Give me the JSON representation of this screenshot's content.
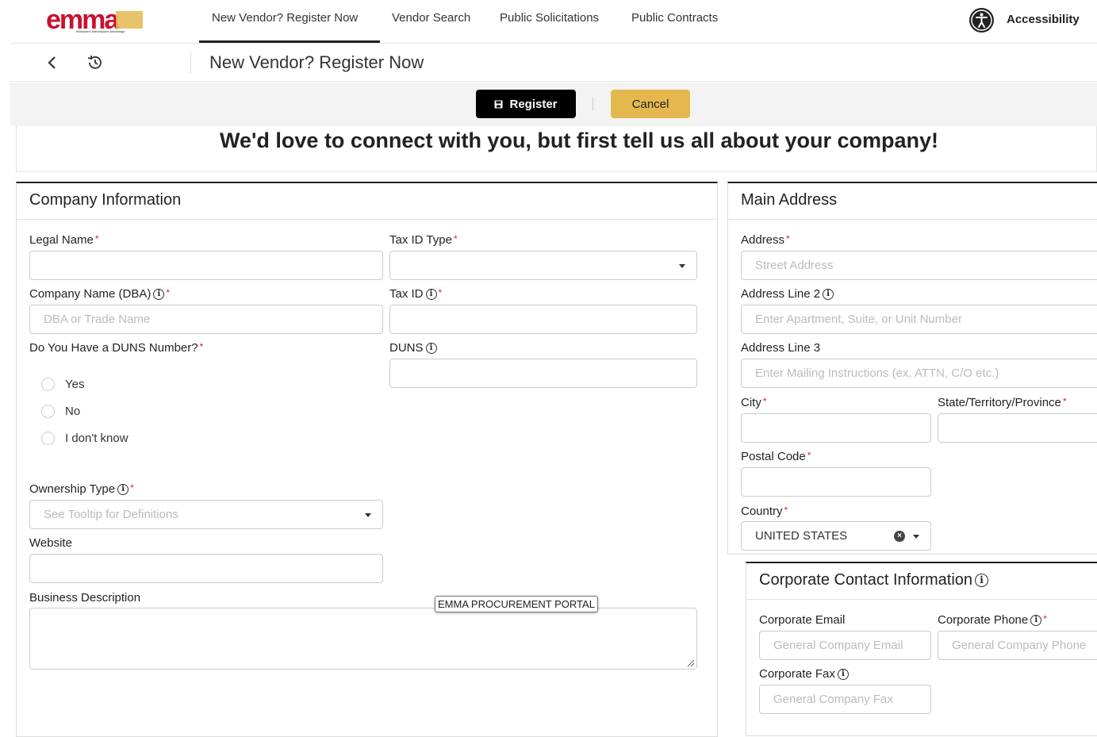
{
  "nav": {
    "logo_text": "emma",
    "logo_tagline": "eMaryland Marketplace Advantage",
    "links": [
      "New Vendor? Register Now",
      "Vendor Search",
      "Public Solicitations",
      "Public Contracts"
    ],
    "active_index": 0,
    "accessibility_label": "Accessibility"
  },
  "subheader": {
    "title": "New Vendor? Register Now",
    "icons": [
      "back-icon",
      "history-icon"
    ]
  },
  "actions": {
    "register_label": "Register",
    "cancel_label": "Cancel"
  },
  "headline": "We'd love to connect with you, but first tell us all about your company!",
  "company": {
    "title": "Company Information",
    "legal_name_label": "Legal Name",
    "tax_id_type_label": "Tax ID Type",
    "dba_label": "Company Name (DBA)",
    "dba_placeholder": "DBA or Trade Name",
    "tax_id_label": "Tax ID",
    "duns_question_label": "Do You Have a DUNS Number?",
    "duns_label": "DUNS",
    "duns_options": [
      "Yes",
      "No",
      "I don't know"
    ],
    "ownership_label": "Ownership Type",
    "ownership_placeholder": "See Tooltip for Definitions",
    "website_label": "Website",
    "business_desc_label": "Business Description",
    "tooltip": "EMMA PROCUREMENT PORTAL"
  },
  "address": {
    "title": "Main Address",
    "address_label": "Address",
    "address_placeholder": "Street Address",
    "line2_label": "Address Line 2",
    "line2_placeholder": "Enter Apartment, Suite, or Unit Number",
    "line3_label": "Address Line 3",
    "line3_placeholder": "Enter Mailing Instructions (ex. ATTN, C/O etc.)",
    "city_label": "City",
    "state_label": "State/Territory/Province",
    "postal_label": "Postal Code",
    "country_label": "Country",
    "country_value": "UNITED STATES"
  },
  "contact": {
    "title": "Corporate Contact Information",
    "email_label": "Corporate Email",
    "email_placeholder": "General Company Email",
    "phone_label": "Corporate Phone",
    "phone_placeholder": "General Company Phone",
    "fax_label": "Corporate Fax",
    "fax_placeholder": "General Company Fax"
  },
  "colors": {
    "accent_gold": "#e4b84f",
    "required": "#dd2222",
    "brand_red": "#c8102e"
  }
}
